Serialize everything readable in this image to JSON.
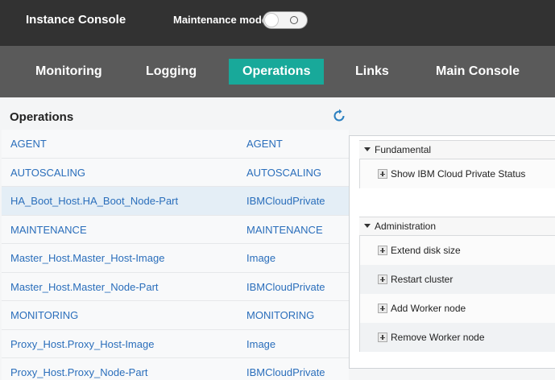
{
  "header": {
    "app_title": "Instance Console",
    "maintenance_label": "Maintenance mode",
    "maintenance_on": false
  },
  "nav": {
    "items": [
      {
        "label": "Monitoring"
      },
      {
        "label": "Logging"
      },
      {
        "label": "Operations"
      },
      {
        "label": "Links"
      },
      {
        "label": "Main Console"
      }
    ],
    "active": "Operations",
    "active_color": "#18a99a"
  },
  "operations": {
    "title": "Operations",
    "refresh_icon": "refresh-icon",
    "rows": [
      {
        "name": "AGENT",
        "type": "AGENT"
      },
      {
        "name": "AUTOSCALING",
        "type": "AUTOSCALING"
      },
      {
        "name": "HA_Boot_Host.HA_Boot_Node-Part",
        "type": "IBMCloudPrivate"
      },
      {
        "name": "MAINTENANCE",
        "type": "MAINTENANCE"
      },
      {
        "name": "Master_Host.Master_Host-Image",
        "type": "Image"
      },
      {
        "name": "Master_Host.Master_Node-Part",
        "type": "IBMCloudPrivate"
      },
      {
        "name": "MONITORING",
        "type": "MONITORING"
      },
      {
        "name": "Proxy_Host.Proxy_Host-Image",
        "type": "Image"
      },
      {
        "name": "Proxy_Host.Proxy_Node-Part",
        "type": "IBMCloudPrivate"
      }
    ],
    "selected_row": "HA_Boot_Host.HA_Boot_Node-Part",
    "link_color": "#2a6ebb"
  },
  "actions": {
    "fundamental": {
      "title": "Fundamental",
      "items": [
        "Show IBM Cloud Private Status"
      ]
    },
    "administration": {
      "title": "Administration",
      "items": [
        "Extend disk size",
        "Restart cluster",
        "Add Worker node",
        "Remove Worker node"
      ]
    }
  }
}
